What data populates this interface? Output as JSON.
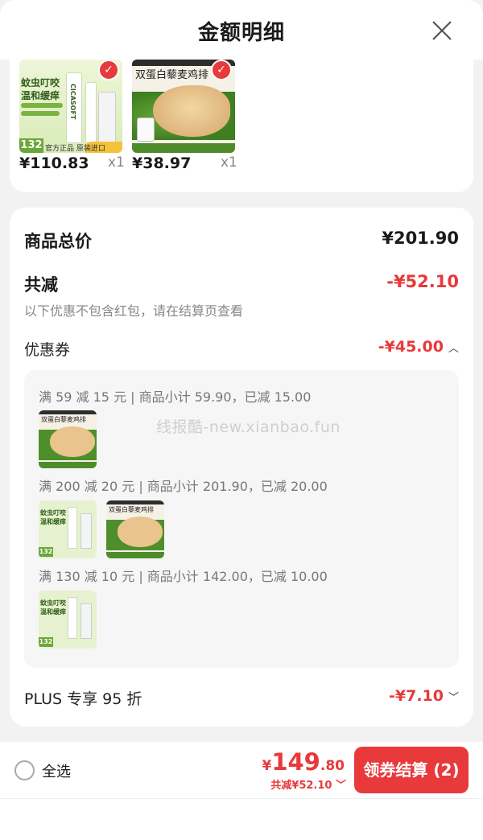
{
  "header": {
    "title": "金额明细"
  },
  "products": [
    {
      "price": "¥110.83",
      "qty": "x1",
      "image_texts": [
        "蚊虫叮咬",
        "温和缓痒",
        "132",
        "官方正品",
        "原装进口",
        "CICASOFT"
      ]
    },
    {
      "price": "¥38.97",
      "qty": "x1",
      "image_texts": [
        "双蛋白藜麦鸡排"
      ]
    }
  ],
  "summary": {
    "total_label": "商品总价",
    "total_value": "¥201.90",
    "reduce_label": "共减",
    "reduce_value": "-¥52.10",
    "note": "以下优惠不包含红包，请在结算页查看",
    "coupon_label": "优惠券",
    "coupon_value": "-¥45.00",
    "plus_label": "PLUS 专享 95 折",
    "plus_value": "-¥7.10"
  },
  "coupon_rules": [
    {
      "text": "满 59 减 15 元 | 商品小计 59.90，已减 15.00"
    },
    {
      "text": "满 200 减 20 元 | 商品小计 201.90，已减 20.00"
    },
    {
      "text": "满 130 减 10 元 | 商品小计 142.00，已减 10.00"
    }
  ],
  "watermark": "线报酷-new.xianbao.fun",
  "footer": {
    "select_all": "全选",
    "currency": "¥",
    "amount_int": "149",
    "amount_dec": ".80",
    "saved": "共减¥52.10",
    "pay_label": "领券结算 (2)"
  },
  "colors": {
    "accent": "#e8393b",
    "bg": "#f2f2f2"
  },
  "icons": [
    "close-icon",
    "check-icon",
    "chevron-up-icon",
    "chevron-down-icon",
    "radio-icon"
  ]
}
